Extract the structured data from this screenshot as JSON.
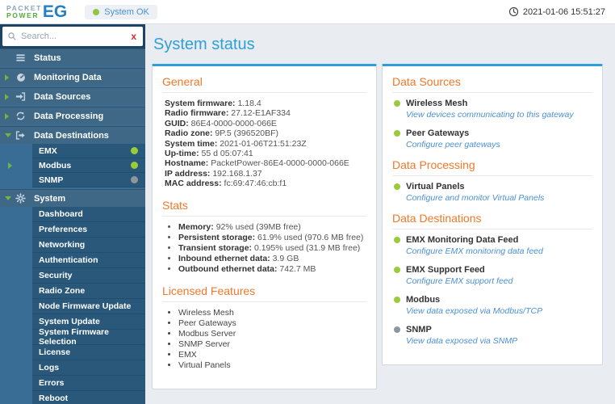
{
  "header": {
    "logo": {
      "line1": "PACKET",
      "line2": "POWER",
      "product": "EG"
    },
    "status_badge": {
      "label": "System OK"
    },
    "timestamp": "2021-01-06 15:51:27"
  },
  "colors": {
    "accent_blue": "#2f9fd8",
    "heading_orange": "#f0782a",
    "link_blue": "#4a90d2",
    "ok_green": "#9acb3b",
    "inactive_gray": "#8e979e",
    "sidebar_blue": "#3a6d96"
  },
  "sidebar": {
    "search": {
      "placeholder": "Search...",
      "clear_label": "x"
    },
    "items": [
      {
        "label": "Status",
        "icon": "list-icon",
        "state": "none"
      },
      {
        "label": "Monitoring Data",
        "icon": "gauge-icon",
        "state": "collapsed"
      },
      {
        "label": "Data Sources",
        "icon": "sign-in-icon",
        "state": "collapsed"
      },
      {
        "label": "Data Processing",
        "icon": "refresh-icon",
        "state": "collapsed"
      },
      {
        "label": "Data Destinations",
        "icon": "sign-out-icon",
        "state": "expanded",
        "children": [
          {
            "label": "EMX",
            "status": "green"
          },
          {
            "label": "Modbus",
            "status": "green",
            "selected": true
          },
          {
            "label": "SNMP",
            "status": "gray"
          }
        ]
      },
      {
        "label": "System",
        "icon": "gear-icon",
        "state": "expanded",
        "children": [
          {
            "label": "Dashboard"
          },
          {
            "label": "Preferences"
          },
          {
            "label": "Networking"
          },
          {
            "label": "Authentication"
          },
          {
            "label": "Security"
          },
          {
            "label": "Radio Zone"
          },
          {
            "label": "Node Firmware Update"
          },
          {
            "label": "System Update"
          },
          {
            "label": "System Firmware Selection"
          },
          {
            "label": "License"
          },
          {
            "label": "Logs"
          },
          {
            "label": "Errors"
          },
          {
            "label": "Reboot"
          }
        ]
      }
    ]
  },
  "main": {
    "title": "System status",
    "left_panel": {
      "general": {
        "heading": "General",
        "rows": [
          {
            "label": "System firmware:",
            "value": "1.18.4"
          },
          {
            "label": "Radio firmware:",
            "value": "27.12-E1AF334"
          },
          {
            "label": "GUID:",
            "value": "86E4-0000-0000-066E"
          },
          {
            "label": "Radio zone:",
            "value": "9P.5 (396520BF)"
          },
          {
            "label": "System time:",
            "value": "2021-01-06T21:51:23Z"
          },
          {
            "label": "Up-time:",
            "value": "55 d 05:07:41"
          },
          {
            "label": "Hostname:",
            "value": "PacketPower-86E4-0000-0000-066E"
          },
          {
            "label": "IP address:",
            "value": "192.168.1.37"
          },
          {
            "label": "MAC address:",
            "value": "fc:69:47:46:cb:f1"
          }
        ]
      },
      "stats": {
        "heading": "Stats",
        "rows": [
          {
            "label": "Memory:",
            "value": "92% used (39MB free)"
          },
          {
            "label": "Persistent storage:",
            "value": "61.9% used (970.6 MB free)"
          },
          {
            "label": "Transient storage:",
            "value": "0.195% used (31.9 MB free)"
          },
          {
            "label": "Inbound ethernet data:",
            "value": "3.9 GB"
          },
          {
            "label": "Outbound ethernet data:",
            "value": "742.7 MB"
          }
        ]
      },
      "licensed": {
        "heading": "Licensed Features",
        "items": [
          "Wireless Mesh",
          "Peer Gateways",
          "Modbus Server",
          "SNMP Server",
          "EMX",
          "Virtual Panels"
        ]
      }
    },
    "right_panel": {
      "sections": [
        {
          "heading": "Data Sources",
          "items": [
            {
              "name": "Wireless Mesh",
              "link": "View devices communicating to this gateway",
              "status": "green"
            },
            {
              "name": "Peer Gateways",
              "link": "Configure peer gateways",
              "status": "green"
            }
          ]
        },
        {
          "heading": "Data Processing",
          "items": [
            {
              "name": "Virtual Panels",
              "link": "Configure and monitor Virtual Panels",
              "status": "green"
            }
          ]
        },
        {
          "heading": "Data Destinations",
          "items": [
            {
              "name": "EMX Monitoring Data Feed",
              "link": "Configure EMX monitoring data feed",
              "status": "green"
            },
            {
              "name": "EMX Support Feed",
              "link": "Configure EMX support feed",
              "status": "green"
            },
            {
              "name": "Modbus",
              "link": "View data exposed via Modbus/TCP",
              "status": "green"
            },
            {
              "name": "SNMP",
              "link": "View data exposed via SNMP",
              "status": "gray"
            }
          ]
        }
      ]
    }
  }
}
